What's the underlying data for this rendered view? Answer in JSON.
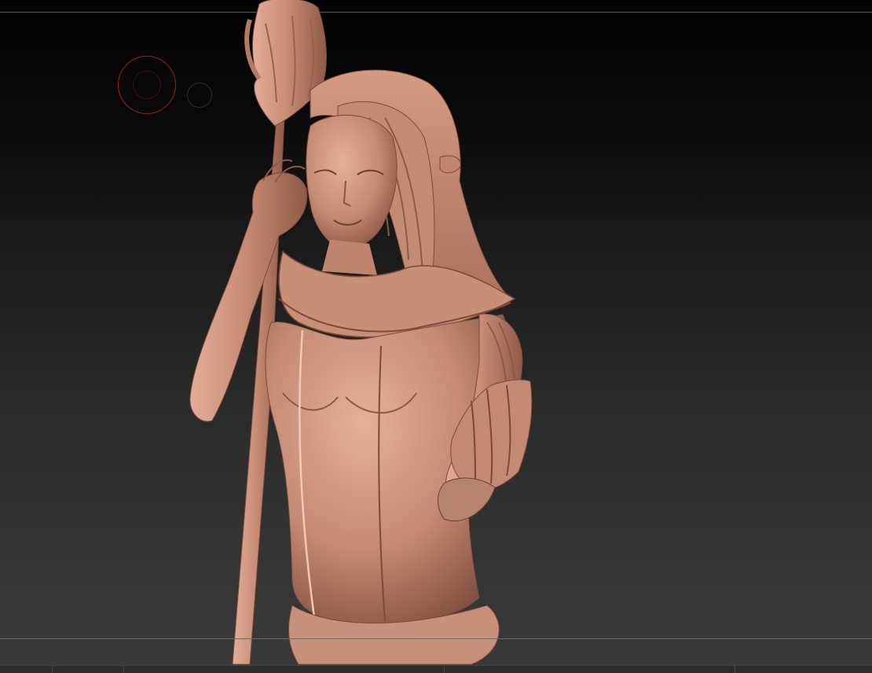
{
  "viewport": {
    "background_top": "#020202",
    "background_bottom": "#3a3a3a"
  },
  "model": {
    "name": "sculpt-bust-icon",
    "clay_color": "#c98d76",
    "clay_shadow": "#7a4a3a",
    "clay_highlight": "#e6b4a0"
  },
  "cursor": {
    "brush_color": "#a81b1b",
    "icon": "brush-circle-icon",
    "lazy_icon": "lazy-mouse-circle-icon"
  }
}
